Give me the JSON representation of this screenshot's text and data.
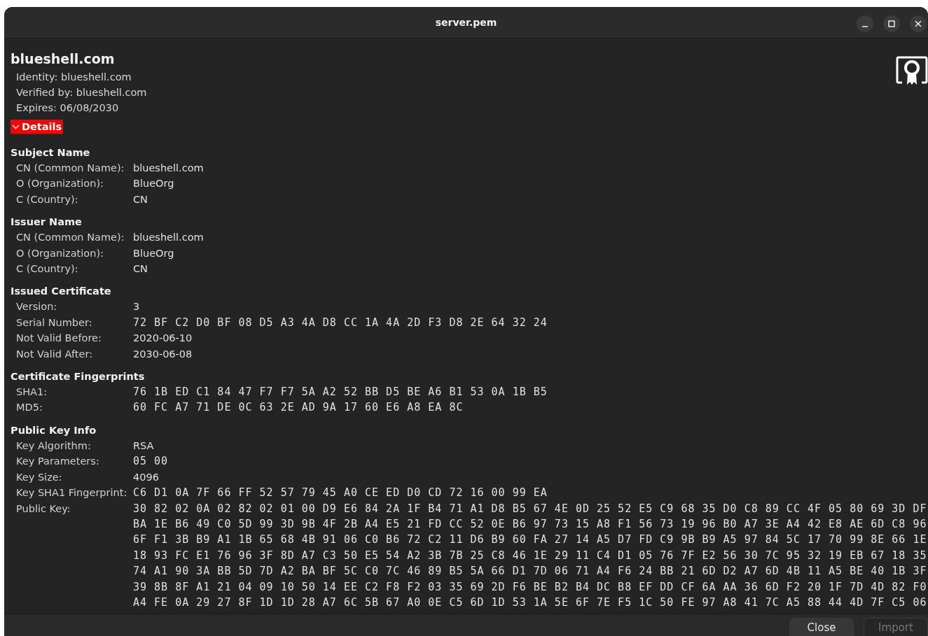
{
  "window": {
    "title": "server.pem"
  },
  "header": {
    "title": "blueshell.com",
    "lines": [
      "Identity: blueshell.com",
      "Verified by: blueshell.com",
      "Expires: 06/08/2030"
    ]
  },
  "details": {
    "label": "Details",
    "expanded": true
  },
  "sections": [
    {
      "title": "Subject Name",
      "rows": [
        {
          "label": "CN (Common Name):",
          "value": "blueshell.com",
          "kind": "text"
        },
        {
          "label": "O (Organization):",
          "value": "BlueOrg",
          "kind": "text"
        },
        {
          "label": "C (Country):",
          "value": "CN",
          "kind": "text"
        }
      ]
    },
    {
      "title": "Issuer Name",
      "rows": [
        {
          "label": "CN (Common Name):",
          "value": "blueshell.com",
          "kind": "text"
        },
        {
          "label": "O (Organization):",
          "value": "BlueOrg",
          "kind": "text"
        },
        {
          "label": "C (Country):",
          "value": "CN",
          "kind": "text"
        }
      ]
    },
    {
      "title": "Issued Certificate",
      "rows": [
        {
          "label": "Version:",
          "value": "3",
          "kind": "text"
        },
        {
          "label": "Serial Number:",
          "value": "72 BF C2 D0 BF 08 D5 A3 4A D8 CC 1A 4A 2D F3 D8 2E 64 32 24",
          "kind": "hex"
        },
        {
          "label": "Not Valid Before:",
          "value": "2020-06-10",
          "kind": "text"
        },
        {
          "label": "Not Valid After:",
          "value": "2030-06-08",
          "kind": "text"
        }
      ]
    },
    {
      "title": "Certificate Fingerprints",
      "rows": [
        {
          "label": "SHA1:",
          "value": "76 1B ED C1 84 47 F7 F7 5A A2 52 BB D5 BE A6 B1 53 0A 1B B5",
          "kind": "hex"
        },
        {
          "label": "MD5:",
          "value": "60 FC A7 71 DE 0C 63 2E AD 9A 17 60 E6 A8 EA 8C",
          "kind": "hex"
        }
      ]
    },
    {
      "title": "Public Key Info",
      "rows": [
        {
          "label": "Key Algorithm:",
          "value": "RSA",
          "kind": "text"
        },
        {
          "label": "Key Parameters:",
          "value": "05 00",
          "kind": "hex"
        },
        {
          "label": "Key Size:",
          "value": "4096",
          "kind": "text"
        },
        {
          "label": "Key SHA1 Fingerprint:",
          "value": "C6 D1 0A 7F 66 FF 52 57 79 45 A0 CE ED D0 CD 72 16 00 99 EA",
          "kind": "hex"
        },
        {
          "label": "Public Key:",
          "kind": "hexblock",
          "lines": [
            "30 82 02 0A 02 82 02 01 00 D9 E6 84 2A 1F B4 71 A1 D8 B5 67 4E 0D 25 52 E5 C9 68 35 D0 C8 89 CC 4F 05 80 69 3D DF",
            "BA 1E B6 49 C0 5D 99 3D 9B 4F 2B A4 E5 21 FD CC 52 0E B6 97 73 15 A8 F1 56 73 19 96 B0 A7 3E A4 42 E8 AE 6D C8 96",
            "6F F1 3B B9 A1 1B 65 68 4B 91 06 C0 B6 72 C2 11 D6 B9 60 FA 27 14 A5 D7 FD C9 9B B9 A5 97 84 5C 17 70 99 8E 66 1E",
            "18 93 FC E1 76 96 3F 8D A7 C3 50 E5 54 A2 3B 7B 25 C8 46 1E 29 11 C4 D1 05 76 7F E2 56 30 7C 95 32 19 EB 67 18 35",
            "74 A1 90 3A BB 5D 7D A2 BA BF 5C C0 7C 46 89 B5 5A 66 D1 7D 06 71 A4 F6 24 BB 21 6D D2 A7 6D 4B 11 A5 BE 40 1B 3F",
            "39 8B 8F A1 21 04 09 10 50 14 EE C2 F8 F2 03 35 69 2D F6 BE B2 B4 DC B8 EF DD CF 6A AA 36 6D F2 20 1F 7D 4D 82 F0",
            "A4 FE 0A 29 27 8F 1D 1D 28 A7 6C 5B 67 A0 0E C5 6D 1D 53 1A 5E 6F 7E F5 1C 50 FE 97 A8 41 7C A5 88 44 4D 7F C5 06"
          ]
        }
      ]
    }
  ],
  "buttons": [
    {
      "label": "Close",
      "disabled": false
    },
    {
      "label": "Import",
      "disabled": true
    }
  ]
}
